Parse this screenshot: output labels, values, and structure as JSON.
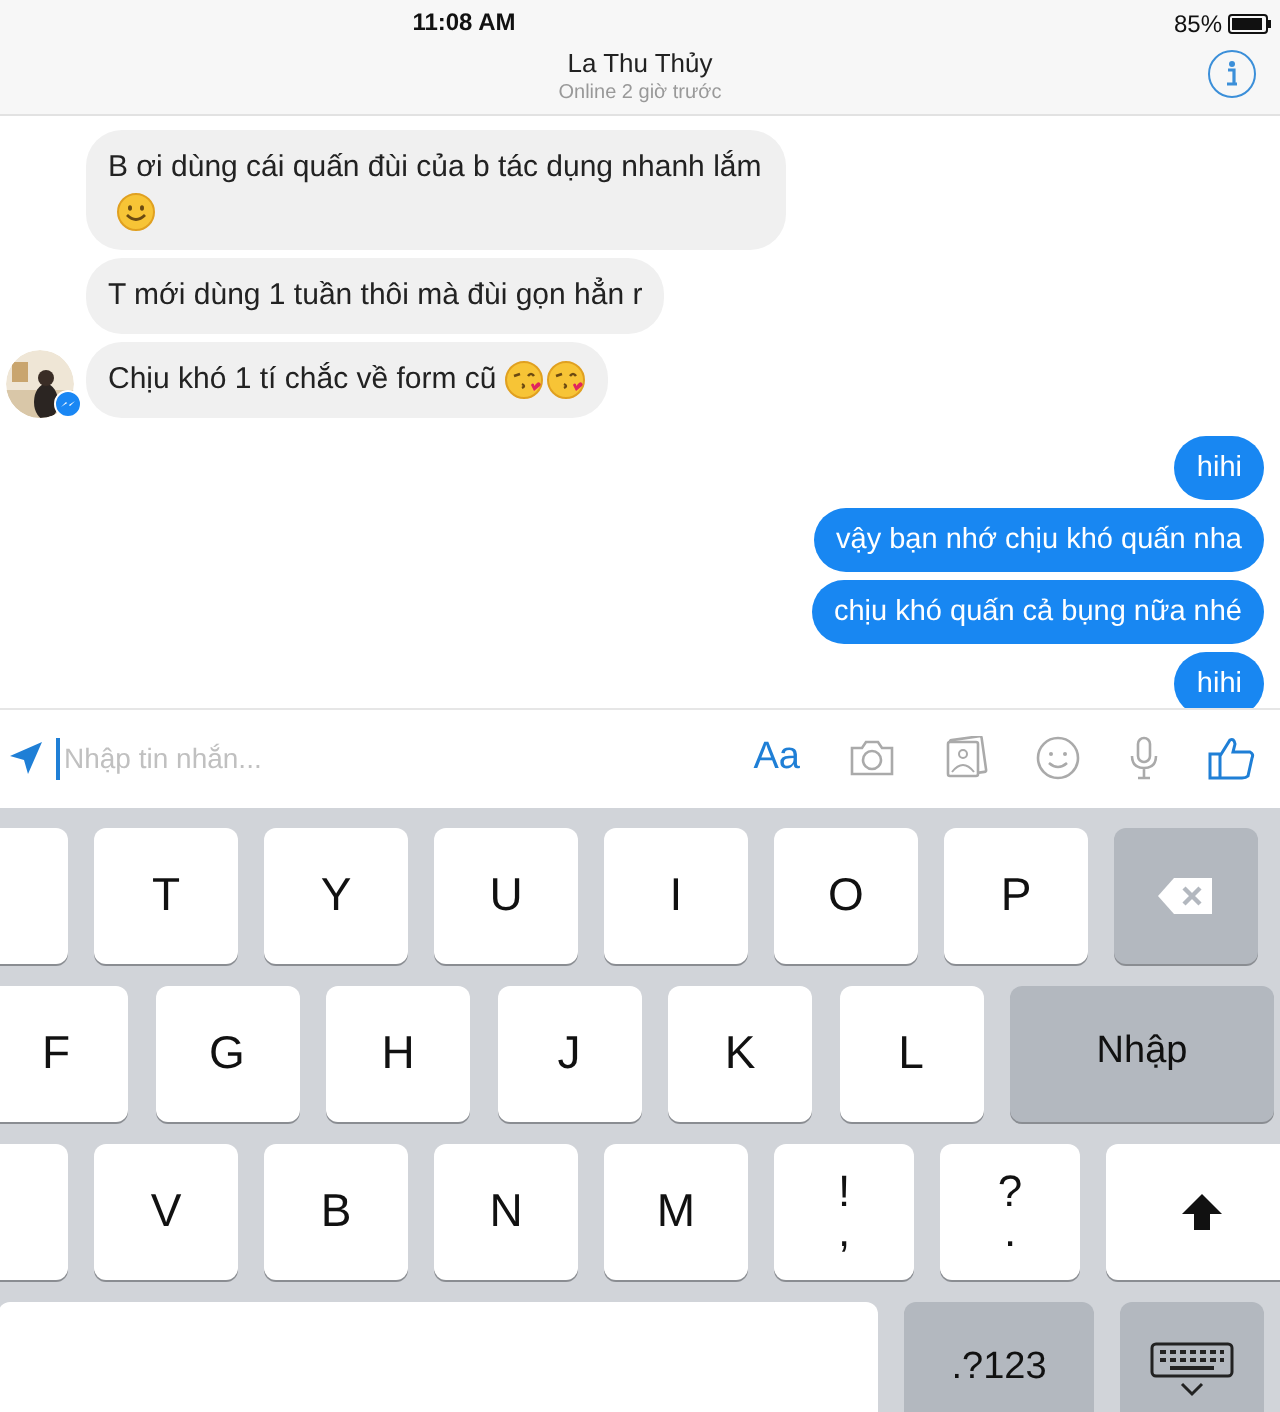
{
  "status_bar": {
    "time": "11:08 AM",
    "battery": "85%"
  },
  "header": {
    "title": "La Thu Thủy",
    "subtitle": "Online 2 giờ trước"
  },
  "messages": [
    {
      "kind": "incoming",
      "text": "B ơi dùng cái quấn đùi của b tác dụng nhanh lắm",
      "emojis": [
        {
          "kind": "smile"
        }
      ],
      "avatar": false
    },
    {
      "kind": "incoming",
      "text": "T mới dùng 1 tuần thôi mà đùi gọn hẳn r",
      "avatar": false
    },
    {
      "kind": "incoming",
      "text": "Chịu khó 1 tí chắc về form cũ",
      "emojis": [
        {
          "kind": "kiss"
        },
        {
          "kind": "kiss"
        }
      ],
      "avatar": true
    },
    {
      "kind": "outgoing",
      "text": "hihi"
    },
    {
      "kind": "outgoing",
      "text": "vậy bạn nhớ chịu khó quấn nha"
    },
    {
      "kind": "outgoing",
      "text": "chịu khó quấn cả bụng nữa nhé"
    },
    {
      "kind": "outgoing",
      "text": "hihi"
    }
  ],
  "composer": {
    "placeholder": "Nhập tin nhắn...",
    "font_button": "Aa"
  },
  "keyboard": {
    "key_rows": [
      {
        "keys": [
          {
            "kind": "partial"
          },
          {
            "kind": "letter",
            "label": "T"
          },
          {
            "kind": "letter",
            "label": "Y"
          },
          {
            "kind": "letter",
            "label": "U"
          },
          {
            "kind": "letter",
            "label": "I"
          },
          {
            "kind": "letter",
            "label": "O"
          },
          {
            "kind": "letter",
            "label": "P"
          },
          {
            "kind": "backspace"
          }
        ]
      },
      {
        "keys": [
          {
            "kind": "letter",
            "label": "F"
          },
          {
            "kind": "letter",
            "label": "G"
          },
          {
            "kind": "letter",
            "label": "H"
          },
          {
            "kind": "letter",
            "label": "J"
          },
          {
            "kind": "letter",
            "label": "K"
          },
          {
            "kind": "letter",
            "label": "L"
          },
          {
            "kind": "return",
            "label": "Nhập"
          }
        ]
      },
      {
        "keys": [
          {
            "kind": "partial"
          },
          {
            "kind": "letter",
            "label": "V"
          },
          {
            "kind": "letter",
            "label": "B"
          },
          {
            "kind": "letter",
            "label": "N"
          },
          {
            "kind": "letter",
            "label": "M"
          },
          {
            "kind": "punct",
            "label": "!",
            "label2": ","
          },
          {
            "kind": "punct",
            "label": "?",
            "label2": "."
          },
          {
            "kind": "shift"
          }
        ]
      },
      {
        "keys": [
          {
            "kind": "space"
          },
          {
            "kind": "numbers",
            "label": ".?123"
          },
          {
            "kind": "hide"
          }
        ]
      }
    ]
  }
}
